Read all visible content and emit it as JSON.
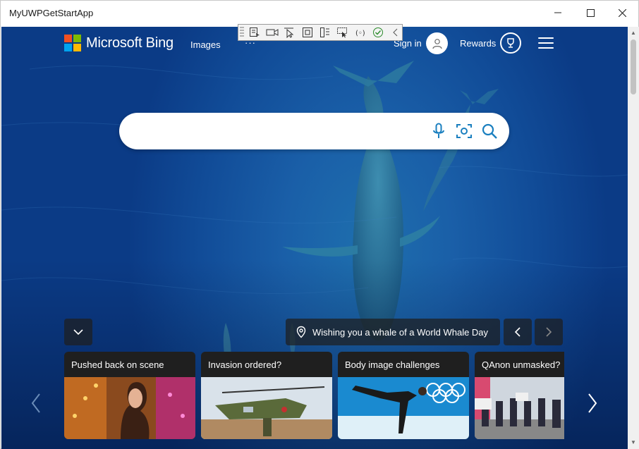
{
  "window": {
    "title": "MyUWPGetStartApp",
    "controls": [
      "minimize",
      "maximize",
      "close"
    ]
  },
  "devtools_toolbar": {
    "icons": [
      "select-element-icon",
      "video-icon",
      "pointer-icon",
      "frame-icon",
      "accessibility-icon",
      "layout-adorner-icon",
      "binding-icon",
      "check-icon",
      "collapse-icon"
    ]
  },
  "bing": {
    "brand": "Microsoft Bing",
    "nav": {
      "images": "Images",
      "more": "···"
    },
    "signin": "Sign in",
    "rewards": "Rewards",
    "search": {
      "placeholder": "",
      "value": ""
    },
    "caption": "Wishing you a whale of a World Whale Day",
    "cards": [
      {
        "title": "Pushed back on scene"
      },
      {
        "title": "Invasion ordered?"
      },
      {
        "title": "Body image challenges"
      },
      {
        "title": "QAnon unmasked?"
      }
    ]
  },
  "colors": {
    "logo_red": "#f25022",
    "logo_green": "#7fba00",
    "logo_blue": "#00a4ef",
    "logo_yellow": "#ffb900",
    "search_icon": "#1a7fbf",
    "background": "#1a5fa8"
  }
}
